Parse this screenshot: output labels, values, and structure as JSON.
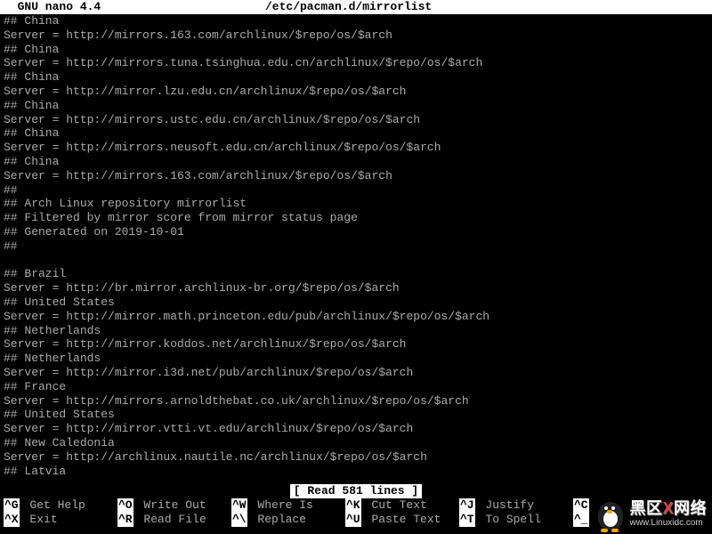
{
  "title": {
    "app": "  GNU nano 4.4",
    "file": "/etc/pacman.d/mirrorlist"
  },
  "content_lines": [
    "## China",
    "Server = http://mirrors.163.com/archlinux/$repo/os/$arch",
    "## China",
    "Server = http://mirrors.tuna.tsinghua.edu.cn/archlinux/$repo/os/$arch",
    "## China",
    "Server = http://mirror.lzu.edu.cn/archlinux/$repo/os/$arch",
    "## China",
    "Server = http://mirrors.ustc.edu.cn/archlinux/$repo/os/$arch",
    "## China",
    "Server = http://mirrors.neusoft.edu.cn/archlinux/$repo/os/$arch",
    "## China",
    "Server = http://mirrors.163.com/archlinux/$repo/os/$arch",
    "##",
    "## Arch Linux repository mirrorlist",
    "## Filtered by mirror score from mirror status page",
    "## Generated on 2019-10-01",
    "##",
    "",
    "## Brazil",
    "Server = http://br.mirror.archlinux-br.org/$repo/os/$arch",
    "## United States",
    "Server = http://mirror.math.princeton.edu/pub/archlinux/$repo/os/$arch",
    "## Netherlands",
    "Server = http://mirror.koddos.net/archlinux/$repo/os/$arch",
    "## Netherlands",
    "Server = http://mirror.i3d.net/pub/archlinux/$repo/os/$arch",
    "## France",
    "Server = http://mirrors.arnoldthebat.co.uk/archlinux/$repo/os/$arch",
    "## United States",
    "Server = http://mirror.vtti.vt.edu/archlinux/$repo/os/$arch",
    "## New Caledonia",
    "Server = http://archlinux.nautile.nc/archlinux/$repo/os/$arch",
    "## Latvia"
  ],
  "status": "[ Read 581 lines ]",
  "shortcuts": {
    "row1": [
      {
        "key": "^G",
        "label": " Get Help"
      },
      {
        "key": "^O",
        "label": " Write Out"
      },
      {
        "key": "^W",
        "label": " Where Is"
      },
      {
        "key": "^K",
        "label": " Cut Text"
      },
      {
        "key": "^J",
        "label": " Justify"
      },
      {
        "key": "^C",
        "label": ""
      }
    ],
    "row2": [
      {
        "key": "^X",
        "label": " Exit"
      },
      {
        "key": "^R",
        "label": " Read File"
      },
      {
        "key": "^\\",
        "label": " Replace"
      },
      {
        "key": "^U",
        "label": " Paste Text"
      },
      {
        "key": "^T",
        "label": " To Spell"
      },
      {
        "key": "^_",
        "label": ""
      }
    ]
  },
  "watermark": {
    "main_pre": "黑区",
    "main_x": "X",
    "main_post": "网络",
    "sub": "www.Linuxidc.com"
  }
}
